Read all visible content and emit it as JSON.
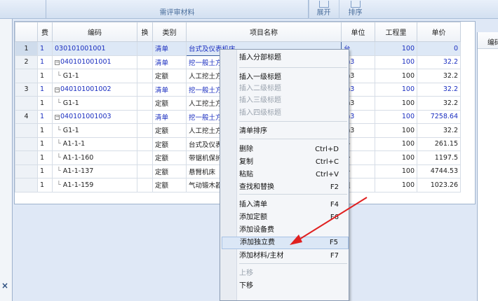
{
  "toolbar": {
    "review_materials": "需评审材料",
    "expand": "展开",
    "sort": "排序"
  },
  "grid": {
    "headers": [
      "",
      "费",
      "编码",
      "换",
      "类别",
      "项目名称",
      "单位",
      "工程里",
      "单价"
    ],
    "rows": [
      {
        "idx": "1",
        "fee": "1",
        "code": "030101001001",
        "tree": "none",
        "cat": "清单",
        "name": "台式及仪表机床",
        "unit": "台",
        "qty": "100",
        "price": "0"
      },
      {
        "idx": "2",
        "fee": "1",
        "code": "040101001001",
        "tree": "box",
        "cat": "清单",
        "name": "挖一般土方",
        "unit": "m3",
        "qty": "100",
        "price": "32.2"
      },
      {
        "idx": "",
        "fee": "1",
        "code": "G1-1",
        "tree": "line",
        "cat": "定额",
        "name": "人工挖土方",
        "unit": "m3",
        "qty": "100",
        "price": "32.2"
      },
      {
        "idx": "3",
        "fee": "1",
        "code": "040101001002",
        "tree": "box",
        "cat": "清单",
        "name": "挖一般土方",
        "unit": "m3",
        "qty": "100",
        "price": "32.2"
      },
      {
        "idx": "",
        "fee": "1",
        "code": "G1-1",
        "tree": "line",
        "cat": "定额",
        "name": "人工挖土方",
        "unit": "m3",
        "qty": "100",
        "price": "32.2"
      },
      {
        "idx": "4",
        "fee": "1",
        "code": "040101001003",
        "tree": "box",
        "cat": "清单",
        "name": "挖一般土方",
        "unit": "m3",
        "qty": "100",
        "price": "7258.64"
      },
      {
        "idx": "",
        "fee": "1",
        "code": "G1-1",
        "tree": "line",
        "cat": "定额",
        "name": "人工挖土方",
        "unit": "m3",
        "qty": "100",
        "price": "32.2"
      },
      {
        "idx": "",
        "fee": "1",
        "code": "A1-1-1",
        "tree": "line",
        "cat": "定额",
        "name": "台式及仪表",
        "unit": "台",
        "qty": "100",
        "price": "261.15"
      },
      {
        "idx": "",
        "fee": "1",
        "code": "A1-1-160",
        "tree": "line",
        "cat": "定额",
        "name": "带锯机保护",
        "unit": "个",
        "qty": "100",
        "price": "1197.5"
      },
      {
        "idx": "",
        "fee": "1",
        "code": "A1-1-137",
        "tree": "line",
        "cat": "定额",
        "name": "悬臂机床",
        "unit": "台",
        "qty": "100",
        "price": "4744.53"
      },
      {
        "idx": "",
        "fee": "1",
        "code": "A1-1-159",
        "tree": "line",
        "cat": "定额",
        "name": "气动锻木器",
        "unit": "组",
        "qty": "100",
        "price": "1023.26"
      }
    ]
  },
  "right_panel": {
    "header": "编码"
  },
  "context_menu": {
    "items": [
      {
        "label": "插入分部标题",
        "shortcut": "",
        "disabled": false
      },
      {
        "label": "插入一级标题",
        "shortcut": "",
        "disabled": false
      },
      {
        "label": "插入二级标题",
        "shortcut": "",
        "disabled": true
      },
      {
        "label": "插入三级标题",
        "shortcut": "",
        "disabled": true
      },
      {
        "label": "插入四级标题",
        "shortcut": "",
        "disabled": true
      },
      {
        "label": "清单排序",
        "shortcut": "",
        "disabled": false
      },
      {
        "label": "删除",
        "shortcut": "Ctrl+D",
        "disabled": false
      },
      {
        "label": "复制",
        "shortcut": "Ctrl+C",
        "disabled": false
      },
      {
        "label": "粘贴",
        "shortcut": "Ctrl+V",
        "disabled": false
      },
      {
        "label": "查找和替换",
        "shortcut": "F2",
        "disabled": false
      },
      {
        "label": "插入清单",
        "shortcut": "F4",
        "disabled": false
      },
      {
        "label": "添加定额",
        "shortcut": "F6",
        "disabled": false
      },
      {
        "label": "添加设备费",
        "shortcut": "",
        "disabled": false
      },
      {
        "label": "添加独立费",
        "shortcut": "F5",
        "disabled": false,
        "highlighted": true
      },
      {
        "label": "添加材料/主材",
        "shortcut": "F7",
        "disabled": false
      },
      {
        "label": "上移",
        "shortcut": "",
        "disabled": true
      },
      {
        "label": "下移",
        "shortcut": "",
        "disabled": false
      }
    ]
  },
  "colors": {
    "annotation_arrow": "#e02020",
    "list_text_blue": "#1a2ec0",
    "ribbon_label": "#4a6e9c"
  },
  "close_glyph": "×"
}
